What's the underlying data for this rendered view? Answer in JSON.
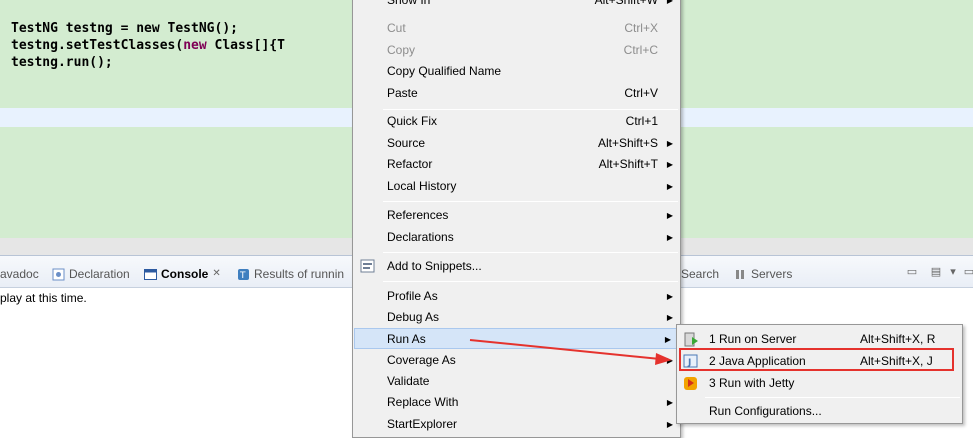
{
  "editor": {
    "line1": "TestNG testng = new TestNG();",
    "line2_pre": "testng.setTestClasses(",
    "line2_kw": "new",
    "line2_post": " Class[]{T",
    "line3": "testng.run();"
  },
  "views": {
    "tabs": [
      {
        "label": "avadoc",
        "icon": "javadoc-icon"
      },
      {
        "label": "Declaration",
        "icon": "declaration-icon"
      },
      {
        "label": "Console",
        "icon": "console-icon",
        "close": "✕"
      },
      {
        "label": "Results of runnin",
        "icon": "testng-results-icon"
      },
      {
        "label": "Search",
        "icon": "search-icon"
      },
      {
        "label": "Servers",
        "icon": "servers-icon"
      }
    ],
    "console_text": "play at this time."
  },
  "menu": {
    "items": [
      {
        "label": "Show In",
        "shortcut": "Alt+Shift+W",
        "arrow": true
      },
      {
        "label": "Cut",
        "shortcut": "Ctrl+X",
        "disabled": true
      },
      {
        "label": "Copy",
        "shortcut": "Ctrl+C",
        "disabled": true
      },
      {
        "label": "Copy Qualified Name",
        "shortcut": ""
      },
      {
        "label": "Paste",
        "shortcut": "Ctrl+V"
      },
      {
        "label": "Quick Fix",
        "shortcut": "Ctrl+1"
      },
      {
        "label": "Source",
        "shortcut": "Alt+Shift+S",
        "arrow": true
      },
      {
        "label": "Refactor",
        "shortcut": "Alt+Shift+T",
        "arrow": true
      },
      {
        "label": "Local History",
        "shortcut": "",
        "arrow": true
      },
      {
        "label": "References",
        "shortcut": "",
        "arrow": true
      },
      {
        "label": "Declarations",
        "shortcut": "",
        "arrow": true
      },
      {
        "label": "Add to Snippets...",
        "shortcut": "",
        "icon": "snippets-icon"
      },
      {
        "label": "Profile As",
        "shortcut": "",
        "arrow": true
      },
      {
        "label": "Debug As",
        "shortcut": "",
        "arrow": true
      },
      {
        "label": "Run As",
        "shortcut": "",
        "arrow": true,
        "hover": true
      },
      {
        "label": "Coverage As",
        "shortcut": "",
        "arrow": true
      },
      {
        "label": "Validate",
        "shortcut": ""
      },
      {
        "label": "Replace With",
        "shortcut": "",
        "arrow": true
      },
      {
        "label": "StartExplorer",
        "shortcut": "",
        "arrow": true
      }
    ]
  },
  "submenu": {
    "items": [
      {
        "label": "1 Run on Server",
        "shortcut": "Alt+Shift+X, R",
        "icon": "run-on-server-icon"
      },
      {
        "label": "2 Java Application",
        "shortcut": "Alt+Shift+X, J",
        "icon": "java-application-icon",
        "highlighted": true
      },
      {
        "label": "3 Run with Jetty",
        "shortcut": "",
        "icon": "jetty-icon"
      },
      {
        "label": "Run Configurations...",
        "shortcut": ""
      }
    ]
  },
  "colors": {
    "annotation_red": "#e5322d",
    "editor_bg": "#d3ecd0",
    "menu_bg": "#f0f0f0",
    "keyword": "#7f0055"
  }
}
